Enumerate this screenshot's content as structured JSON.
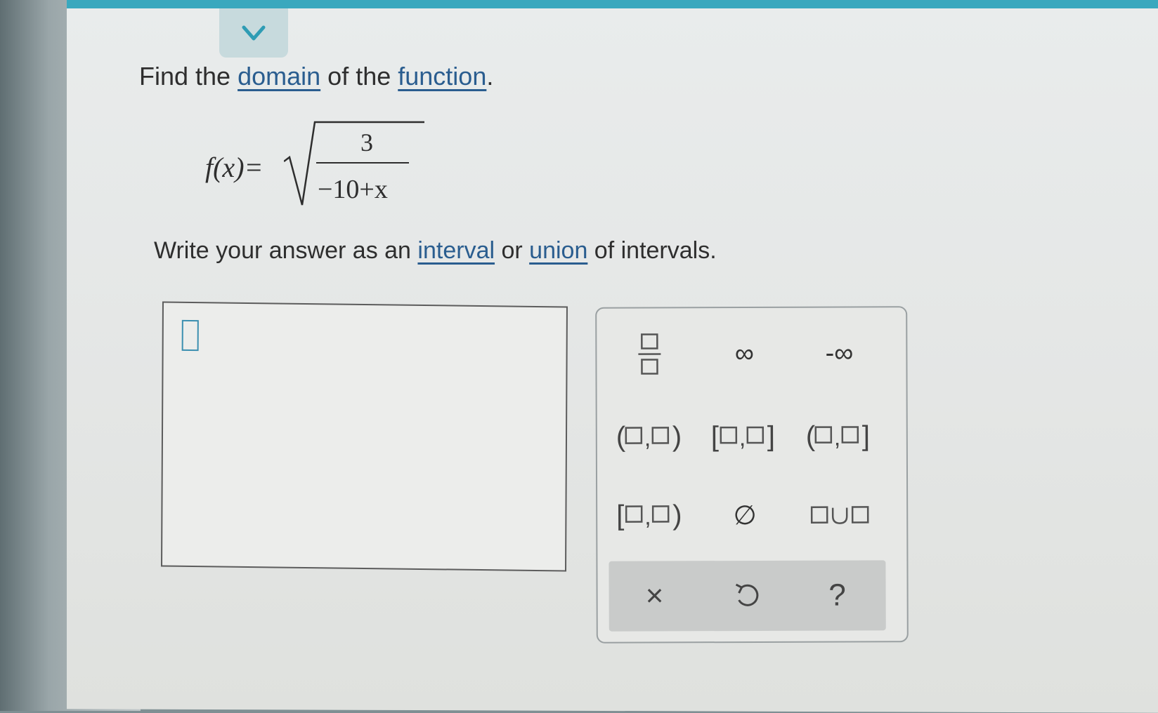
{
  "question": {
    "prefix": "Find the ",
    "link1": "domain",
    "middle": " of the ",
    "link2": "function",
    "suffix": "."
  },
  "formula": {
    "lhs": "f(x)=",
    "numerator": "3",
    "denominator": "−10+x"
  },
  "instruction": {
    "prefix": "Write your answer as an ",
    "link1": "interval",
    "middle": " or ",
    "link2": "union",
    "suffix": " of intervals."
  },
  "palette": {
    "infinity": "∞",
    "neg_infinity": "-∞",
    "empty_set": "∅",
    "clear": "×",
    "help": "?"
  },
  "colors": {
    "accent": "#3aa8be",
    "link": "#2a5d8f",
    "cursor": "#3b8fb0"
  }
}
